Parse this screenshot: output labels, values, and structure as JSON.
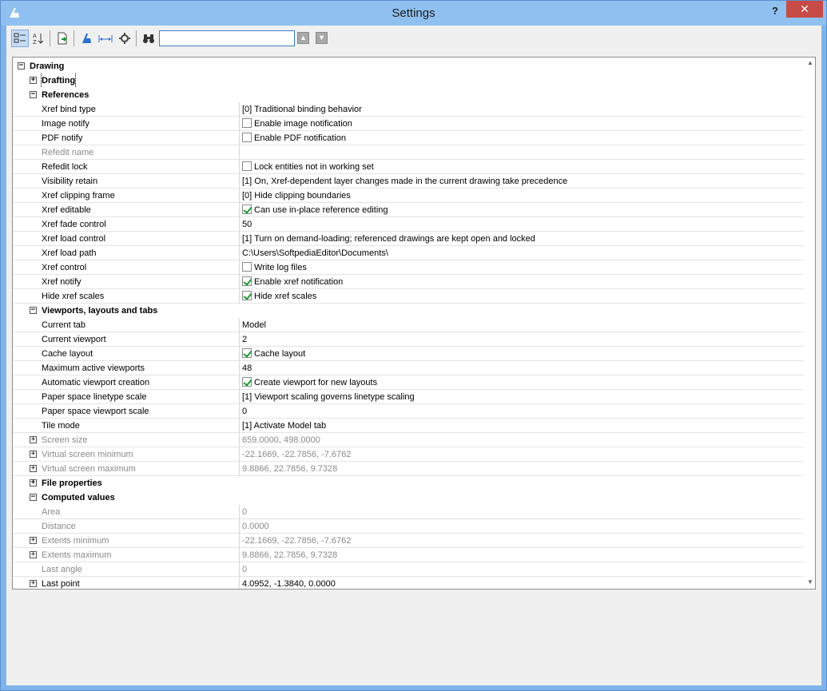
{
  "window": {
    "title": "Settings",
    "help_label": "?",
    "close_label": "✕"
  },
  "toolbar": {
    "search_value": "",
    "buttons": [
      "categorized-view",
      "alphabetic-view",
      "export",
      "set-variable",
      "dimension",
      "settings",
      "find"
    ],
    "up_label": "▲",
    "down_label": "▼"
  },
  "rows": [
    {
      "kind": "cat",
      "level": 0,
      "exp": "−",
      "name": "Drawing"
    },
    {
      "kind": "cat",
      "level": 1,
      "exp": "+",
      "name": "Drafting",
      "focus": true
    },
    {
      "kind": "cat",
      "level": 1,
      "exp": "−",
      "name": "References"
    },
    {
      "kind": "prop",
      "level": 2,
      "name": "Xref bind type",
      "value": "[0] Traditional binding behavior"
    },
    {
      "kind": "prop",
      "level": 2,
      "name": "Image notify",
      "checkbox": false,
      "value": "Enable image notification"
    },
    {
      "kind": "prop",
      "level": 2,
      "name": "PDF notify",
      "checkbox": false,
      "value": "Enable PDF notification"
    },
    {
      "kind": "prop",
      "level": 2,
      "name": "Refedit name",
      "value": "",
      "disabled": true
    },
    {
      "kind": "prop",
      "level": 2,
      "name": "Refedit lock",
      "checkbox": false,
      "value": "Lock entities not in working set"
    },
    {
      "kind": "prop",
      "level": 2,
      "name": "Visibility retain",
      "value": "[1] On, Xref-dependent layer changes made in the current drawing take precedence"
    },
    {
      "kind": "prop",
      "level": 2,
      "name": "Xref clipping frame",
      "value": "[0] Hide clipping boundaries"
    },
    {
      "kind": "prop",
      "level": 2,
      "name": "Xref editable",
      "checkbox": true,
      "value": "Can use in-place reference editing"
    },
    {
      "kind": "prop",
      "level": 2,
      "name": "Xref fade control",
      "value": "50"
    },
    {
      "kind": "prop",
      "level": 2,
      "name": "Xref load control",
      "value": "[1] Turn on demand-loading; referenced drawings are kept open and locked"
    },
    {
      "kind": "prop",
      "level": 2,
      "name": "Xref load path",
      "value": "C:\\Users\\SoftpediaEditor\\Documents\\"
    },
    {
      "kind": "prop",
      "level": 2,
      "name": "Xref control",
      "checkbox": false,
      "value": "Write log files"
    },
    {
      "kind": "prop",
      "level": 2,
      "name": "Xref notify",
      "checkbox": true,
      "value": "Enable xref notification"
    },
    {
      "kind": "prop",
      "level": 2,
      "name": "Hide xref scales",
      "checkbox": true,
      "value": "Hide xref scales"
    },
    {
      "kind": "cat",
      "level": 1,
      "exp": "−",
      "name": "Viewports, layouts and tabs"
    },
    {
      "kind": "prop",
      "level": 2,
      "name": "Current tab",
      "value": "Model"
    },
    {
      "kind": "prop",
      "level": 2,
      "name": "Current viewport",
      "value": "2"
    },
    {
      "kind": "prop",
      "level": 2,
      "name": "Cache layout",
      "checkbox": true,
      "value": "Cache layout"
    },
    {
      "kind": "prop",
      "level": 2,
      "name": "Maximum active viewports",
      "value": "48"
    },
    {
      "kind": "prop",
      "level": 2,
      "name": "Automatic viewport creation",
      "checkbox": true,
      "value": "Create viewport for new layouts"
    },
    {
      "kind": "prop",
      "level": 2,
      "name": "Paper space linetype scale",
      "value": "[1] Viewport scaling governs linetype scaling"
    },
    {
      "kind": "prop",
      "level": 2,
      "name": "Paper space viewport scale",
      "value": "0"
    },
    {
      "kind": "prop",
      "level": 2,
      "name": "Tile mode",
      "value": "[1] Activate Model tab"
    },
    {
      "kind": "prop",
      "level": 2,
      "exp": "+",
      "name": "Screen size",
      "value": "659.0000, 498.0000",
      "disabled": true
    },
    {
      "kind": "prop",
      "level": 2,
      "exp": "+",
      "name": "Virtual screen minimum",
      "value": "-22.1669, -22.7856, -7.6762",
      "disabled": true
    },
    {
      "kind": "prop",
      "level": 2,
      "exp": "+",
      "name": "Virtual screen maximum",
      "value": "9.8866, 22.7856, 9.7328",
      "disabled": true
    },
    {
      "kind": "cat",
      "level": 1,
      "exp": "+",
      "name": "File properties"
    },
    {
      "kind": "cat",
      "level": 1,
      "exp": "−",
      "name": "Computed values"
    },
    {
      "kind": "prop",
      "level": 2,
      "name": "Area",
      "value": "0",
      "disabled": true
    },
    {
      "kind": "prop",
      "level": 2,
      "name": "Distance",
      "value": "0.0000",
      "disabled": true
    },
    {
      "kind": "prop",
      "level": 2,
      "exp": "+",
      "name": "Extents minimum",
      "value": "-22.1669, -22.7856, -7.6762",
      "disabled": true
    },
    {
      "kind": "prop",
      "level": 2,
      "exp": "+",
      "name": "Extents maximum",
      "value": "9.8866, 22.7856, 9.7328",
      "disabled": true
    },
    {
      "kind": "prop",
      "level": 2,
      "name": "Last angle",
      "value": "0",
      "disabled": true
    },
    {
      "kind": "prop",
      "level": 2,
      "exp": "+",
      "name": "Last point",
      "value": "4.0952, -1.3840, 0.0000"
    }
  ]
}
